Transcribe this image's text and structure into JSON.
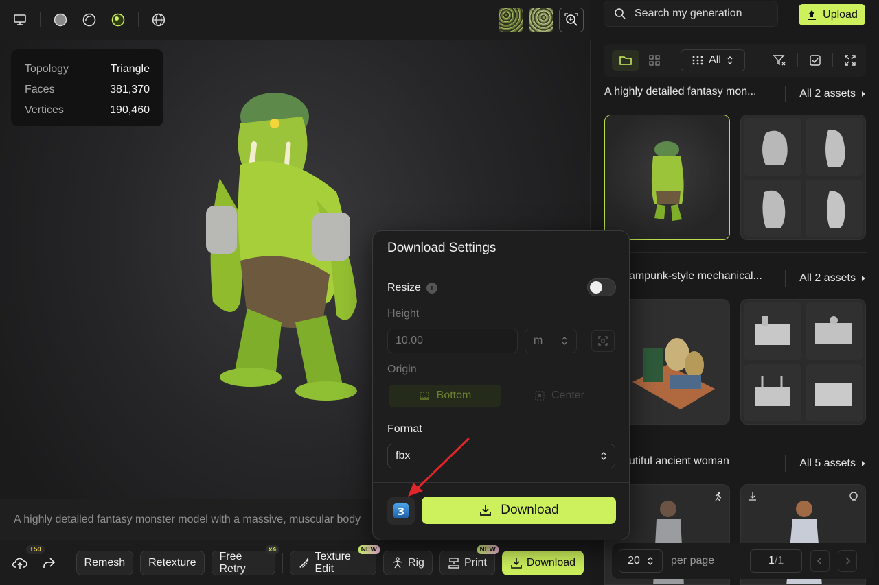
{
  "stats": {
    "topology_label": "Topology",
    "topology_value": "Triangle",
    "faces_label": "Faces",
    "faces_value": "381,370",
    "vertices_label": "Vertices",
    "vertices_value": "190,460"
  },
  "prompt_text": "A highly detailed fantasy monster model with a massive, muscular body",
  "bottom_bar": {
    "credits_badge": "+50",
    "remesh": "Remesh",
    "retexture": "Retexture",
    "free_retry": "Free Retry",
    "free_retry_badge": "x4",
    "texture_edit": "Texture Edit",
    "texture_edit_badge": "NEW",
    "rig": "Rig",
    "print": "Print",
    "print_badge": "NEW",
    "download": "Download"
  },
  "panel": {
    "search_placeholder": "Search my generation",
    "upload": "Upload",
    "filter_all": "All",
    "groups": [
      {
        "title": "A highly detailed fantasy mon...",
        "all": "All 2 assets"
      },
      {
        "title": "ampunk-style mechanical...",
        "all": "All 2 assets"
      },
      {
        "title": "utiful ancient woman",
        "all": "All 5 assets"
      }
    ],
    "pager": {
      "per_page_value": "20",
      "per_page_label": "per page",
      "page": "1",
      "total": "1"
    }
  },
  "modal": {
    "title": "Download Settings",
    "resize_label": "Resize",
    "height_label": "Height",
    "height_value": "10.00",
    "unit": "m",
    "origin_label": "Origin",
    "origin_bottom": "Bottom",
    "origin_center": "Center",
    "format_label": "Format",
    "format_value": "fbx",
    "download": "Download",
    "resize_enabled": false
  },
  "colors": {
    "accent": "#cdf15c",
    "annotation_arrow": "#e0262b"
  }
}
